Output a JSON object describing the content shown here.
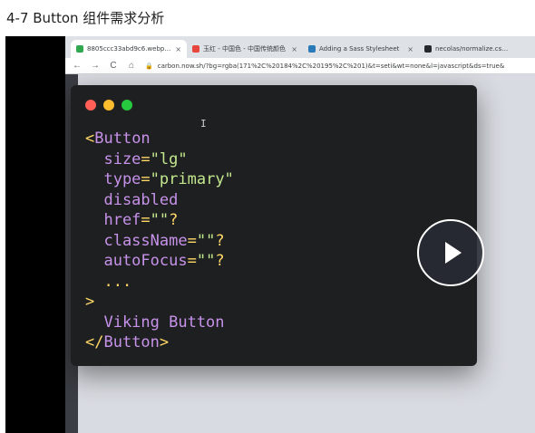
{
  "page": {
    "title": "4-7 Button 组件需求分析"
  },
  "browser": {
    "tabs": [
      {
        "label": "8805ccc33abd9c6.webp (82…",
        "favicon_color": "#2fa84f",
        "close": "×"
      },
      {
        "label": "玉红 - 中国色 - 中国传统颜色",
        "favicon_color": "#e8453c",
        "close": "×"
      },
      {
        "label": "Adding a Sass Stylesheet",
        "favicon_color": "#2a7ab8",
        "close": "×"
      },
      {
        "label": "necolas/normalize.cs…",
        "favicon_color": "#24292e",
        "close": ""
      }
    ],
    "toolbar": {
      "back": "←",
      "forward": "→",
      "reload": "C",
      "home": "⌂",
      "lock": "🔒",
      "url": "carbon.now.sh/?bg=rgba(171%2C%20184%2C%20195%2C%201)&t=seti&wt=none&l=javascript&ds=true&"
    }
  },
  "code_window": {
    "lines": [
      [
        {
          "t": "<",
          "c": "punct"
        },
        {
          "t": "Button",
          "c": "tag"
        }
      ],
      [
        {
          "t": "  size",
          "c": "attr"
        },
        {
          "t": "=",
          "c": "punct"
        },
        {
          "t": "\"lg\"",
          "c": "str"
        }
      ],
      [
        {
          "t": "  type",
          "c": "attr"
        },
        {
          "t": "=",
          "c": "punct"
        },
        {
          "t": "\"primary\"",
          "c": "str"
        }
      ],
      [
        {
          "t": "  disabled",
          "c": "attr"
        }
      ],
      [
        {
          "t": "  href",
          "c": "attr"
        },
        {
          "t": "=",
          "c": "punct"
        },
        {
          "t": "\"\"",
          "c": "str"
        },
        {
          "t": "?",
          "c": "punct"
        }
      ],
      [
        {
          "t": "  className",
          "c": "attr"
        },
        {
          "t": "=",
          "c": "punct"
        },
        {
          "t": "\"\"",
          "c": "str"
        },
        {
          "t": "?",
          "c": "punct"
        }
      ],
      [
        {
          "t": "  autoFocus",
          "c": "attr"
        },
        {
          "t": "=",
          "c": "punct"
        },
        {
          "t": "\"\"",
          "c": "str"
        },
        {
          "t": "?",
          "c": "punct"
        }
      ],
      [
        {
          "t": "  ...",
          "c": "punct"
        }
      ],
      [
        {
          "t": ">",
          "c": "punct"
        }
      ],
      [
        {
          "t": "  Viking Button",
          "c": "text"
        }
      ],
      [
        {
          "t": "</",
          "c": "punct"
        },
        {
          "t": "Button",
          "c": "tag"
        },
        {
          "t": ">",
          "c": "punct"
        }
      ]
    ],
    "cursor": "I"
  },
  "colors": {
    "tag": "#c792ea",
    "punct": "#ffd866",
    "string": "#c3e88d",
    "window_bg": "#1e1f21"
  },
  "player": {
    "play_icon": "play-icon"
  }
}
